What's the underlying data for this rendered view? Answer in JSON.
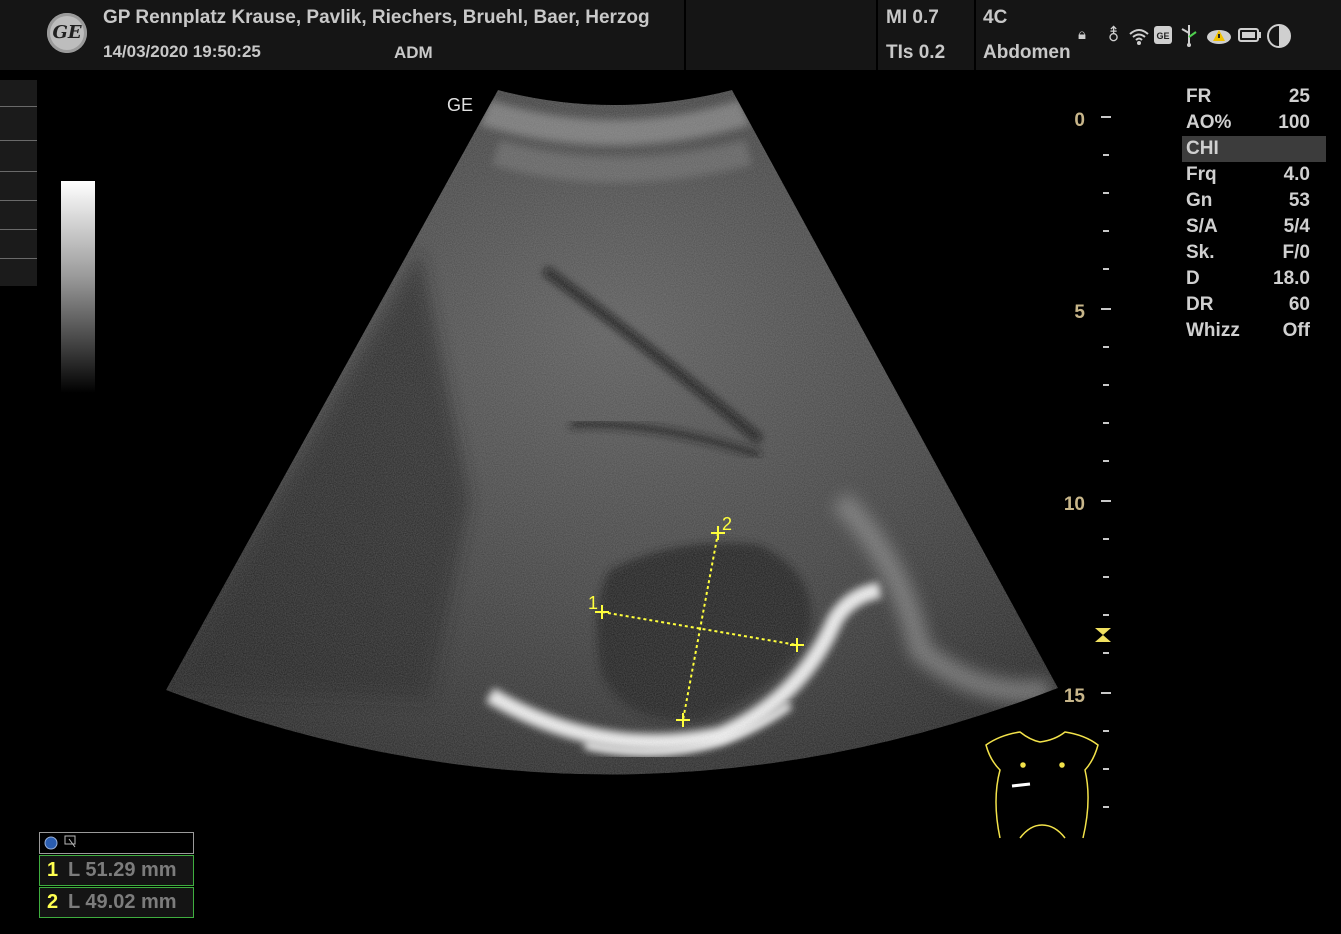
{
  "header": {
    "logo_text": "GE",
    "institution": "GP Rennplatz Krause, Pavlik, Riechers, Bruehl, Baer, Herzog",
    "datetime": "14/03/2020 19:50:25",
    "operator": "ADM",
    "mi": "MI 0.7",
    "tis": "TIs 0.2",
    "probe": "4C",
    "preset": "Abdomen"
  },
  "status_icons": [
    "lock-icon",
    "usb-icon",
    "wifi-icon",
    "ge-badge-icon",
    "network-icon",
    "warning-cloud-icon",
    "battery-icon",
    "contrast-icon"
  ],
  "image": {
    "orientation_marker": "GE"
  },
  "params": [
    {
      "key": "FR",
      "value": "25"
    },
    {
      "key": "AO%",
      "value": "100"
    },
    {
      "key": "CHI",
      "value": ""
    },
    {
      "key": "Frq",
      "value": "4.0"
    },
    {
      "key": "Gn",
      "value": "53"
    },
    {
      "key": "S/A",
      "value": "5/4"
    },
    {
      "key": "Sk.",
      "value": "F/0"
    },
    {
      "key": "D",
      "value": "18.0"
    },
    {
      "key": "DR",
      "value": "60"
    },
    {
      "key": "Whizz",
      "value": "Off"
    }
  ],
  "depth_scale": {
    "labels": [
      "0",
      "5",
      "10",
      "15"
    ]
  },
  "measurements": [
    {
      "num": "1",
      "text": "L  51.29 mm"
    },
    {
      "num": "2",
      "text": "L  49.02 mm"
    }
  ],
  "calipers": {
    "label1": "1",
    "label2": "2"
  },
  "colors": {
    "caliper": "#ffff3c",
    "depth_labels": "#c8b68a",
    "measure_border": "#3fae3f"
  }
}
